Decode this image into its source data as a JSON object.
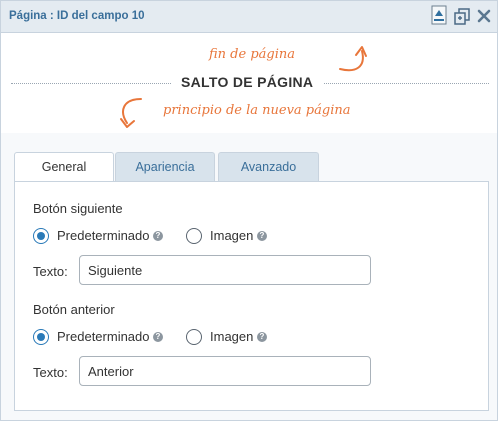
{
  "header": {
    "title": "Página : ID del campo 10",
    "icons": [
      "collapse-icon",
      "duplicate-icon",
      "close-icon"
    ]
  },
  "page_break": {
    "end_note": "fin de página",
    "label": "SALTO DE PÁGINA",
    "start_note": "principio de la nueva página"
  },
  "tabs": [
    {
      "label": "General",
      "active": true
    },
    {
      "label": "Apariencia",
      "active": false
    },
    {
      "label": "Avanzado",
      "active": false
    }
  ],
  "next_button": {
    "section_label": "Botón siguiente",
    "option_default": "Predeterminado",
    "option_image": "Imagen",
    "selected": "Predeterminado",
    "text_label": "Texto:",
    "text_value": "Siguiente"
  },
  "prev_button": {
    "section_label": "Botón anterior",
    "option_default": "Predeterminado",
    "option_image": "Imagen",
    "selected": "Predeterminado",
    "text_label": "Texto:",
    "text_value": "Anterior"
  },
  "colors": {
    "accent": "#3a6f9a",
    "handwriting": "#e8763b",
    "radio": "#2a7ab8"
  }
}
